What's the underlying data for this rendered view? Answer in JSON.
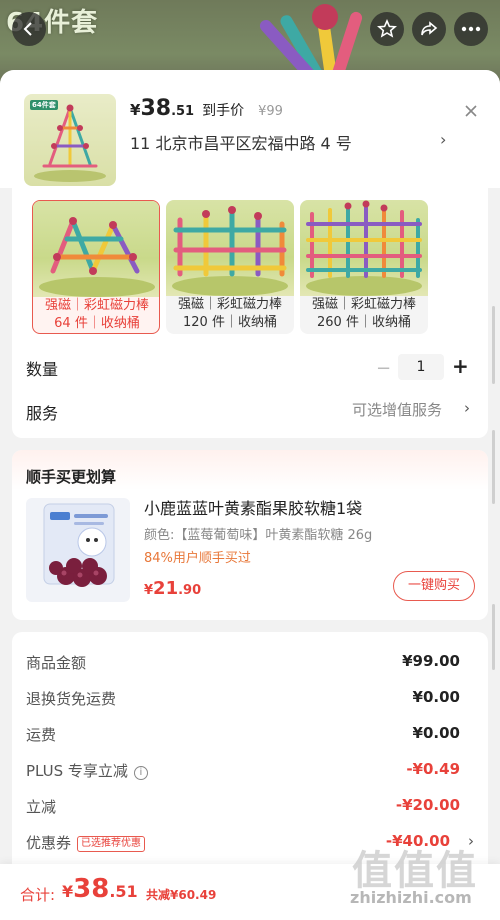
{
  "hero": {
    "title": "64件套"
  },
  "header": {
    "price_currency": "¥",
    "price_int": "38",
    "price_dec": ".51",
    "price_note": "到手价",
    "original_price": "¥99",
    "address": "11  北京市昌平区宏福中路 4 号",
    "thumb_badge": "64件套"
  },
  "variants": [
    {
      "line1": "强磁｜彩虹磁力棒",
      "line2": "64 件｜收纳桶",
      "selected": true
    },
    {
      "line1": "强磁｜彩虹磁力棒",
      "line2": "120 件｜收纳桶",
      "selected": false
    },
    {
      "line1": "强磁｜彩虹磁力棒",
      "line2": "260 件｜收纳桶",
      "selected": false
    }
  ],
  "quantity": {
    "label": "数量",
    "value": "1",
    "minus": "−",
    "plus": "+"
  },
  "service": {
    "label": "服务",
    "value": "可选增值服务"
  },
  "addon": {
    "section_title": "顺手买更划算",
    "product_title": "小鹿蓝蓝叶黄素酯果胶软糖1袋",
    "variant": "颜色:【蓝莓葡萄味】叶黄素酯软糖 26g",
    "hint": "84%用户顺手买过",
    "price_currency": "¥",
    "price_int": "21",
    "price_dec": ".90",
    "buy_label": "一键购买"
  },
  "fees": [
    {
      "label": "商品金额",
      "value": "¥99.00",
      "red": false
    },
    {
      "label": "退换货免运费",
      "value": "¥0.00",
      "red": false
    },
    {
      "label": "运费",
      "value": "¥0.00",
      "red": false
    },
    {
      "label": "PLUS 专享立减",
      "value": "-¥0.49",
      "red": true
    },
    {
      "label": "立减",
      "value": "-¥20.00",
      "red": true
    },
    {
      "label": "优惠券",
      "value": "-¥40.00",
      "red": true,
      "tag": "已选推荐优惠"
    }
  ],
  "bottom": {
    "total_label": "合计:",
    "currency": "¥",
    "total_int": "38",
    "total_dec": ".51",
    "saved": "共减¥60.49"
  },
  "watermark": {
    "logo": "值值值",
    "url": "zhizhizhi.com"
  },
  "colors": {
    "accent": "#e8413a",
    "hint": "#e8783a"
  }
}
